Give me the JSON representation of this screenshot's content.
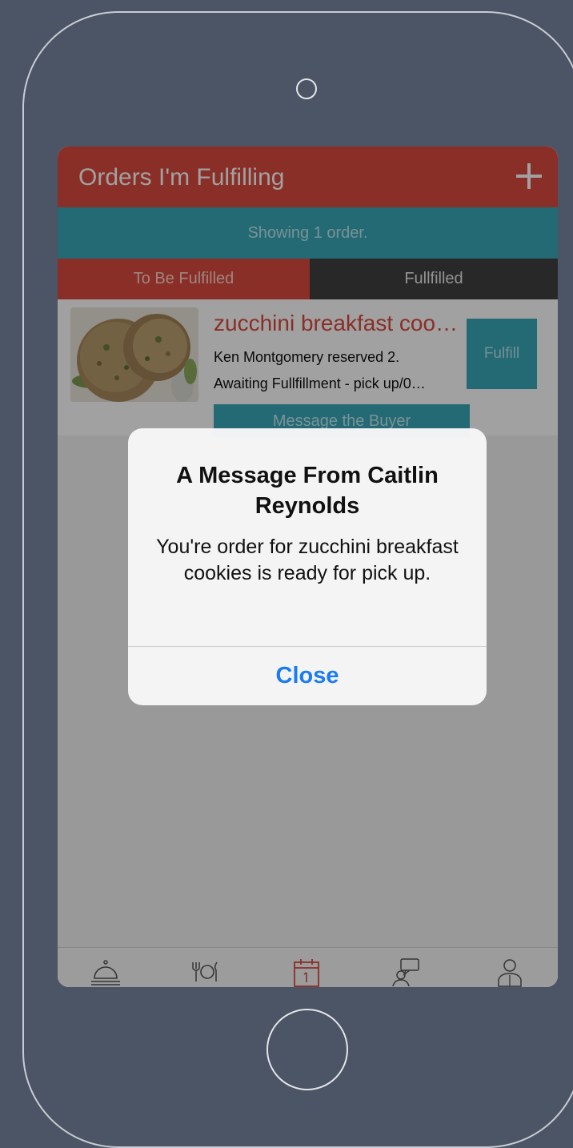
{
  "header": {
    "title": "Orders I'm Fulfilling",
    "add_icon": "plus-icon"
  },
  "info_bar": {
    "text": "Showing 1 order."
  },
  "tabs": [
    {
      "label": "To Be Fulfilled",
      "active": true
    },
    {
      "label": "Fullfilled",
      "active": false
    }
  ],
  "order": {
    "title": "zucchini breakfast coo…",
    "reserved_text": "Ken Montgomery reserved 2.",
    "status_text": "Awaiting Fullfillment - pick up/0…",
    "fulfill_label": "Fulfill",
    "message_label": "Message the Buyer"
  },
  "alert": {
    "title": "A Message From Caitlin Reynolds",
    "message": "You're order for zucchini breakfast cookies is ready for pick up.",
    "close_label": "Close"
  },
  "tabbar": [
    {
      "icon": "service-bell-icon",
      "active": false
    },
    {
      "icon": "dining-icon",
      "active": false
    },
    {
      "icon": "calendar-icon",
      "active": true
    },
    {
      "icon": "chat-icon",
      "active": false
    },
    {
      "icon": "profile-icon",
      "active": false
    }
  ],
  "colors": {
    "primary_red": "#d94b3f",
    "teal": "#3aa9b9",
    "alert_button_blue": "#1a7cf2",
    "background": "#4b5566"
  }
}
